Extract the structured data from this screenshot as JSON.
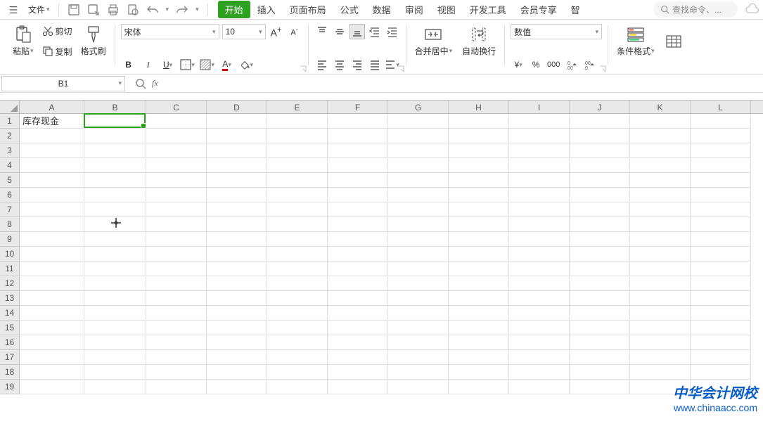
{
  "menubar": {
    "file_label": "文件",
    "search_placeholder": "查找命令、..."
  },
  "tabs": {
    "start": "开始",
    "insert": "插入",
    "page_layout": "页面布局",
    "formula": "公式",
    "data": "数据",
    "review": "审阅",
    "view": "视图",
    "dev_tools": "开发工具",
    "member": "会员专享",
    "more": "智"
  },
  "clipboard": {
    "paste": "粘贴",
    "cut": "剪切",
    "copy": "复制",
    "format_painter": "格式刷"
  },
  "font": {
    "name": "宋体",
    "size": "10"
  },
  "alignment": {
    "merge_center": "合并居中",
    "wrap": "自动换行"
  },
  "number": {
    "format": "数值"
  },
  "styles": {
    "cond_format": "条件格式"
  },
  "formula_bar": {
    "cell_ref": "B1",
    "fx": "fx",
    "formula": ""
  },
  "grid": {
    "columns": [
      "A",
      "B",
      "C",
      "D",
      "E",
      "F",
      "G",
      "H",
      "I",
      "J",
      "K",
      "L"
    ],
    "rows": [
      "1",
      "2",
      "3",
      "4",
      "5",
      "6",
      "7",
      "8",
      "9",
      "10",
      "11",
      "12",
      "13",
      "14",
      "15",
      "16",
      "17",
      "18",
      "19"
    ],
    "cells": {
      "A1": "库存现金"
    },
    "active_cell": "B1"
  },
  "watermark": {
    "title": "中华会计网校",
    "url": "www.chinaacc.com"
  }
}
